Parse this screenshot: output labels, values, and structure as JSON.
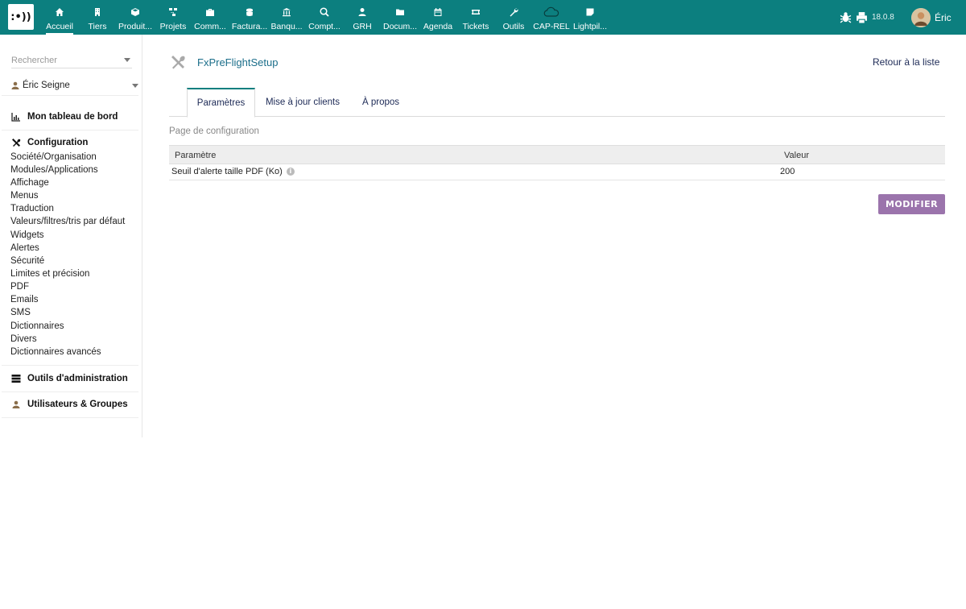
{
  "topbar": {
    "version": "18.0.8",
    "username": "Éric",
    "nav": [
      {
        "label": "Accueil",
        "icon": "home-icon"
      },
      {
        "label": "Tiers",
        "icon": "building-icon"
      },
      {
        "label": "Produit...",
        "icon": "box-icon"
      },
      {
        "label": "Projets",
        "icon": "project-icon"
      },
      {
        "label": "Comm...",
        "icon": "briefcase-icon"
      },
      {
        "label": "Factura...",
        "icon": "coins-icon"
      },
      {
        "label": "Banqu...",
        "icon": "bank-icon"
      },
      {
        "label": "Compt...",
        "icon": "search-dollar-icon"
      },
      {
        "label": "GRH",
        "icon": "user-tie-icon"
      },
      {
        "label": "Docum...",
        "icon": "folder-icon"
      },
      {
        "label": "Agenda",
        "icon": "calendar-icon"
      },
      {
        "label": "Tickets",
        "icon": "ticket-icon"
      },
      {
        "label": "Outils",
        "icon": "wrench-icon"
      },
      {
        "label": "CAP-REL",
        "icon": "cloud-icon"
      },
      {
        "label": "Lightpil...",
        "icon": "note-icon"
      }
    ]
  },
  "sidebar": {
    "search_placeholder": "Rechercher",
    "user_select": "Éric Seigne",
    "dashboard": "Mon tableau de bord",
    "configuration": "Configuration",
    "config_items": [
      "Société/Organisation",
      "Modules/Applications",
      "Affichage",
      "Menus",
      "Traduction",
      "Valeurs/filtres/tris par défaut",
      "Widgets",
      "Alertes",
      "Sécurité",
      "Limites et précision",
      "PDF",
      "Emails",
      "SMS",
      "Dictionnaires",
      "Divers",
      "Dictionnaires avancés"
    ],
    "admin_tools": "Outils d'administration",
    "users_groups": "Utilisateurs & Groupes"
  },
  "main": {
    "title": "FxPreFlightSetup",
    "back_link": "Retour à la liste",
    "tabs": [
      "Paramètres",
      "Mise à jour clients",
      "À propos"
    ],
    "section_title": "Page de configuration",
    "table": {
      "headers": [
        "Paramètre",
        "Valeur"
      ],
      "rows": [
        {
          "param": "Seuil d'alerte taille PDF (Ko)",
          "value": "200"
        }
      ]
    },
    "modify_button": "MODIFIER"
  },
  "colors": {
    "topbar": "#0c7f7f",
    "button": "#9b74ac",
    "link": "#1d2a56"
  }
}
